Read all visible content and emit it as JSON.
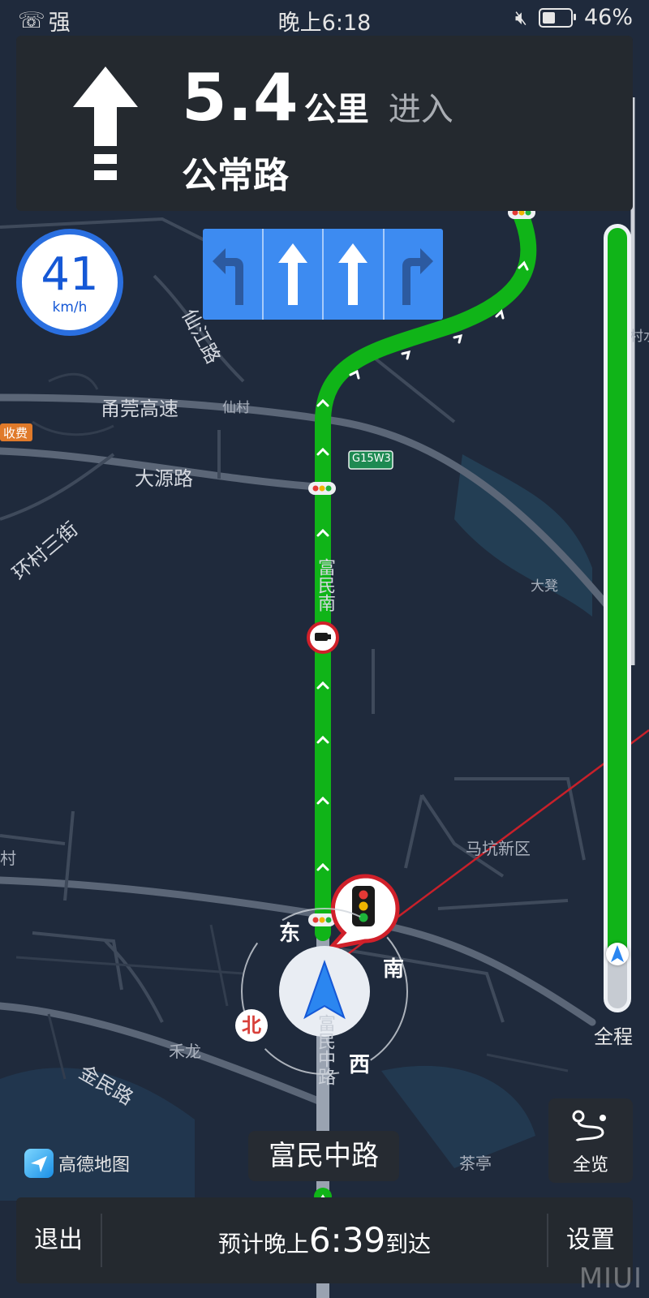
{
  "status_bar": {
    "signal_text": "强",
    "time": "晚上6:18",
    "battery_text": "46%",
    "battery_level": 0.46
  },
  "nav": {
    "distance_value": "5.4",
    "distance_unit": "公里",
    "action": "进入",
    "next_road": "公常路",
    "turn_icon": "straight-arrow-icon"
  },
  "lanes": [
    {
      "direction": "left-turn",
      "recommended": false
    },
    {
      "direction": "straight",
      "recommended": true
    },
    {
      "direction": "straight",
      "recommended": true
    },
    {
      "direction": "right-turn",
      "recommended": false
    }
  ],
  "speed": {
    "value": "41",
    "unit": "km/h"
  },
  "map": {
    "labels": {
      "road_xianjiang": "仙江路",
      "expressway": "甬莞高速",
      "xiancun": "仙村",
      "toll": "收费",
      "road_dayuan": "大源路",
      "road_huancun": "环村三街",
      "highway_shield": "G15W3",
      "road_fumin_south": "富民南",
      "dadeng": "大凳",
      "makeng": "马坑新区",
      "cun": "村",
      "helong": "禾龙",
      "road_jinmin": "金民路",
      "road_fumin_middle_vertical": "富民中路",
      "chating": "茶亭",
      "partial_right": "村水"
    }
  },
  "compass": {
    "east": "东",
    "south": "南",
    "west": "西",
    "north": "北"
  },
  "progress": {
    "label": "全程",
    "traveled_fraction": 0.07
  },
  "logo": {
    "text": "高德地图"
  },
  "overview_button": {
    "label": "全览"
  },
  "current_road": "富民中路",
  "bottom_bar": {
    "exit": "退出",
    "eta_prefix": "预计晚上",
    "eta_time": "6:39",
    "eta_suffix": "到达",
    "settings": "设置"
  },
  "watermark": "MIUI",
  "colors": {
    "route": "#10b418",
    "lane_bg": "#3d8bf1",
    "speed_ring": "#2a6fe0",
    "north_badge": "#d8403a"
  }
}
